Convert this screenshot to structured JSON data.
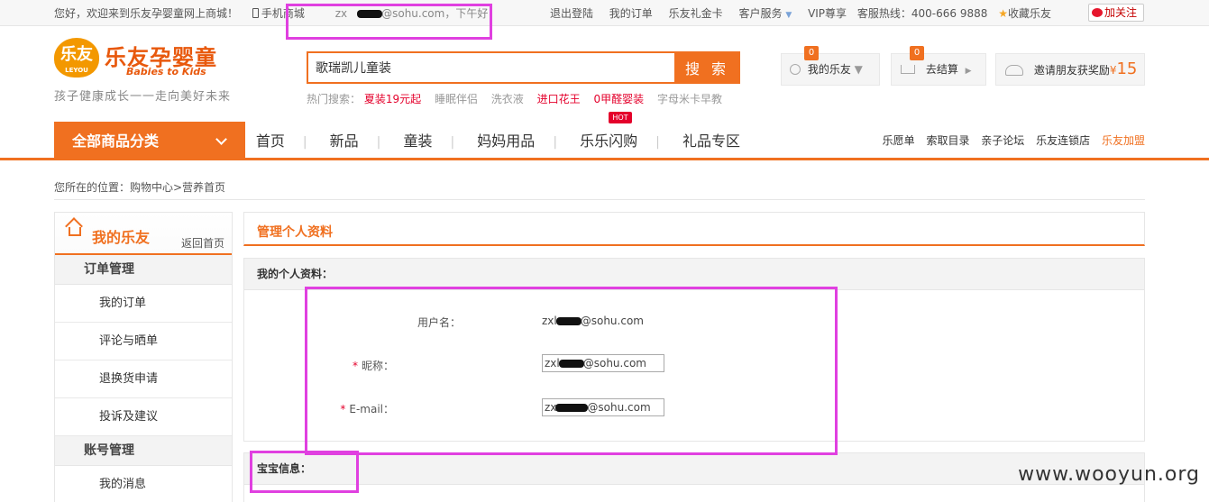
{
  "topbar": {
    "greeting": "您好，欢迎来到乐友孕婴童网上商城！",
    "mobile_mall": "手机商城",
    "email_prefix": "zx",
    "email_suffix": "@sohu.com，下午好！",
    "links": [
      "退出登陆",
      "我的订单",
      "乐友礼金卡",
      "客户服务",
      "VIP尊享"
    ],
    "hotline": "客服热线：400-666 9888",
    "favorite": "收藏乐友",
    "follow": "加关注"
  },
  "header": {
    "logo_text": "乐友",
    "logo_small": "LEYOU",
    "brand_name": "乐友孕婴童",
    "brand_en": "Babies to Kids",
    "slogan": "孩子健康成长一一走向美好未来",
    "search_value": "歌瑞凯儿童装",
    "search_button": "搜 索",
    "hot_label": "热门搜索：",
    "hot_items": [
      {
        "text": "夏装19元起",
        "red": true
      },
      {
        "text": "睡眠伴侣",
        "red": false
      },
      {
        "text": "洗衣液",
        "red": false
      },
      {
        "text": "进口花王",
        "red": true
      },
      {
        "text": "0甲醛婴装",
        "red": true
      },
      {
        "text": "字母米卡早教",
        "red": false
      }
    ],
    "my_leyou": "我的乐友",
    "my_leyou_badge": "0",
    "checkout": "去结算",
    "checkout_badge": "0",
    "invite": "邀请朋友获奖励",
    "invite_currency": "¥",
    "invite_amount": "15"
  },
  "nav": {
    "all_categories": "全部商品分类",
    "items": [
      "首页",
      "新品",
      "童装",
      "妈妈用品",
      "乐乐闪购",
      "礼品专区"
    ],
    "hot_tag": "HOT",
    "links": [
      "乐愿单",
      "索取目录",
      "亲子论坛",
      "乐友连锁店",
      "乐友加盟"
    ]
  },
  "breadcrumb": "您所在的位置：购物中心>营养首页",
  "sidebar": {
    "title": "我的乐友",
    "back": "返回首页",
    "groups": [
      {
        "title": "订单管理",
        "items": [
          "我的订单",
          "评论与晒单",
          "退换货申请",
          "投诉及建议"
        ]
      },
      {
        "title": "账号管理",
        "items": [
          "我的消息"
        ]
      }
    ]
  },
  "main": {
    "title": "管理个人资料",
    "profile": {
      "section_title": "我的个人资料：",
      "username_label": "用户名：",
      "username_prefix": "zxl",
      "username_suffix": "@sohu.com",
      "nickname_label": "昵称：",
      "nickname_prefix": "zxl",
      "nickname_suffix": "@sohu.com",
      "email_label": "E-mail：",
      "email_prefix": "zx",
      "email_suffix": "@sohu.com",
      "required_mark": "*"
    },
    "baby": {
      "section_title": "宝宝信息："
    }
  },
  "watermark": "www.wooyun.org",
  "colors": {
    "accent": "#f07020",
    "highlight_annotation": "#e040e0",
    "hot_red": "#e4002b"
  }
}
